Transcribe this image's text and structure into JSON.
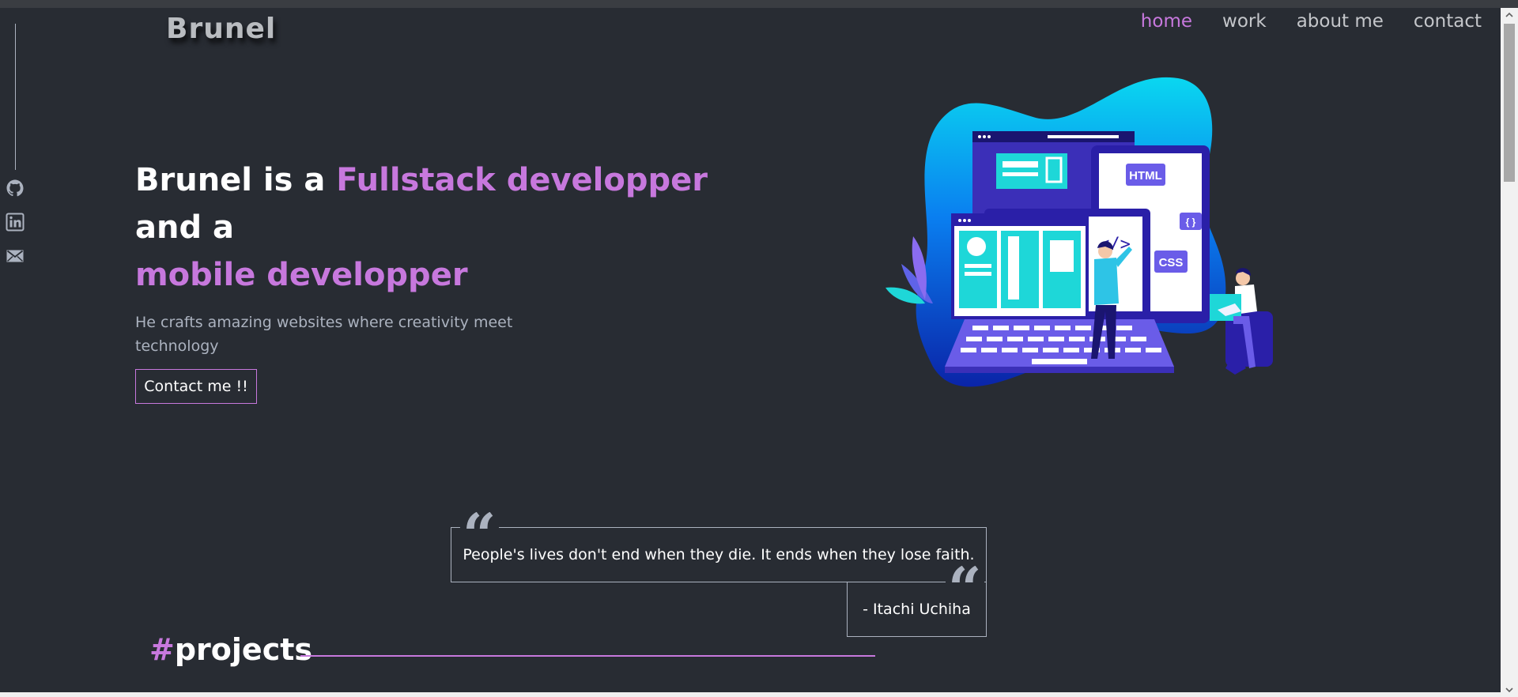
{
  "header": {
    "logo": "Brunel",
    "nav": [
      {
        "label": "home",
        "active": true
      },
      {
        "label": "work",
        "active": false
      },
      {
        "label": "about me",
        "active": false
      },
      {
        "label": "contact",
        "active": false
      }
    ]
  },
  "social": [
    {
      "icon": "github-icon"
    },
    {
      "icon": "linkedin-icon"
    },
    {
      "icon": "mail-icon"
    }
  ],
  "hero": {
    "title_part1": "Brunel is a ",
    "title_accent1": "Fullstack developper",
    "title_part2": " and a",
    "title_accent2": "mobile developper",
    "subtitle": "He crafts amazing websites where creativity meet technology",
    "cta_label": "Contact me !!"
  },
  "quote": {
    "text": "People's lives don't end when they die. It ends when they lose faith.",
    "author": "- Itachi Uchiha",
    "mark": "“"
  },
  "projects": {
    "hash": "#",
    "title": "projects"
  },
  "illustration": {
    "html_label": "HTML",
    "css_label": "CSS",
    "braces_label": "{ }",
    "code_label": "</>"
  },
  "colors": {
    "background": "#282c33",
    "accent": "#c778dd",
    "text": "#ffffff",
    "muted": "#abb2bf"
  }
}
